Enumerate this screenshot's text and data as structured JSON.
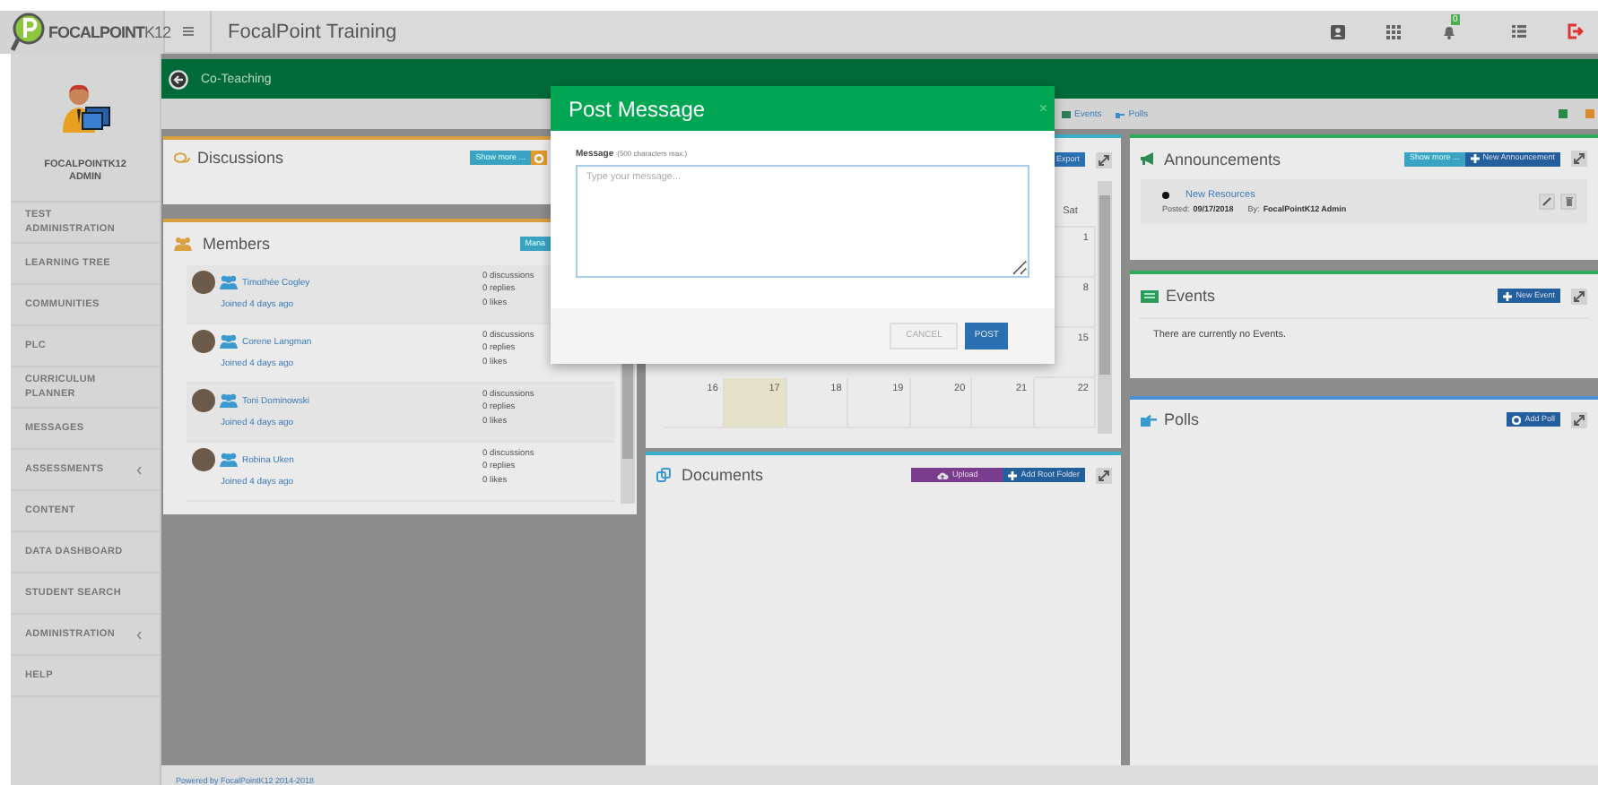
{
  "header": {
    "logo": "**FOCALPOINT**K12",
    "title": "FocalPoint Training",
    "notification_count": "0"
  },
  "sidebar": {
    "user": "FOCALPOINTK12 ADMIN",
    "items": [
      {
        "label": "TEST ADMINISTRATION",
        "has_submenu": false
      },
      {
        "label": "LEARNING TREE",
        "has_submenu": false
      },
      {
        "label": "COMMUNITIES",
        "has_submenu": false
      },
      {
        "label": "PLC",
        "has_submenu": false
      },
      {
        "label": "CURRICULUM PLANNER",
        "has_submenu": false
      },
      {
        "label": "MESSAGES",
        "has_submenu": false
      },
      {
        "label": "ASSESSMENTS",
        "has_submenu": true
      },
      {
        "label": "CONTENT",
        "has_submenu": false
      },
      {
        "label": "DATA DASHBOARD",
        "has_submenu": false
      },
      {
        "label": "STUDENT SEARCH",
        "has_submenu": false
      },
      {
        "label": "ADMINISTRATION",
        "has_submenu": true
      },
      {
        "label": "HELP",
        "has_submenu": false
      }
    ]
  },
  "page": {
    "title": "Co-Teaching",
    "tabs": [
      {
        "label": "Events",
        "kind": "events"
      },
      {
        "label": "Polls",
        "kind": "polls"
      }
    ]
  },
  "discussions": {
    "title": "Discussions",
    "button": "Show more ..."
  },
  "members": {
    "title": "Members",
    "button": "Mana",
    "rows": [
      {
        "name": "Timothée Cogley",
        "joined": "Joined 4 days ago",
        "discussions": "0 discussions",
        "replies": "0 replies",
        "likes": "0 likes"
      },
      {
        "name": "Corene Langman",
        "joined": "Joined 4 days ago",
        "discussions": "0 discussions",
        "replies": "0 replies",
        "likes": "0 likes"
      },
      {
        "name": "Toni Dominowski",
        "joined": "Joined 4 days ago",
        "discussions": "0 discussions",
        "replies": "0 replies",
        "likes": "0 likes"
      },
      {
        "name": "Robina Uken",
        "joined": "Joined 4 days ago",
        "discussions": "0 discussions",
        "replies": "0 replies",
        "likes": "0 likes"
      }
    ]
  },
  "calendar": {
    "button": "Export",
    "weekday": "Sat",
    "rows": [
      {
        "cells": [
          {
            "day": "1",
            "today": false
          }
        ]
      },
      {
        "cells": [
          {
            "day": "8",
            "today": false
          }
        ]
      },
      {
        "cells": [
          {
            "day": "15",
            "today": false
          }
        ]
      },
      {
        "cells": [
          {
            "day": "16",
            "today": false
          },
          {
            "day": "17",
            "today": true
          },
          {
            "day": "18",
            "today": false
          },
          {
            "day": "19",
            "today": false
          },
          {
            "day": "20",
            "today": false
          },
          {
            "day": "21",
            "today": false
          },
          {
            "day": "22",
            "today": false
          }
        ]
      }
    ]
  },
  "documents": {
    "title": "Documents",
    "buttons": [
      {
        "label": "Upload",
        "kind": "upload"
      },
      {
        "label": "Add Root Folder",
        "kind": "add"
      }
    ]
  },
  "announcements": {
    "title": "Announcements",
    "buttons": [
      {
        "label": "Show more ...",
        "kind": "more"
      },
      {
        "label": "New Announcement",
        "kind": "add"
      }
    ],
    "items": [
      {
        "title": "New Resources",
        "posted_label": "Posted:",
        "date": "09/17/2018",
        "by_label": "By:",
        "author": "FocalPointK12 Admin"
      }
    ]
  },
  "events": {
    "title": "Events",
    "button": "New Event",
    "empty_text": "There are currently no Events."
  },
  "polls": {
    "title": "Polls",
    "button": "Add Poll"
  },
  "footer": "Powered by FocalPointK12 2014-2018",
  "modal": {
    "title": "Post Message",
    "close": "×",
    "field_label": "Message",
    "field_hint": "(500 characters max.)",
    "placeholder": "Type your message...",
    "buttons": [
      {
        "label": "CANCEL",
        "kind": "secondary"
      },
      {
        "label": "POST",
        "kind": "primary"
      }
    ]
  }
}
